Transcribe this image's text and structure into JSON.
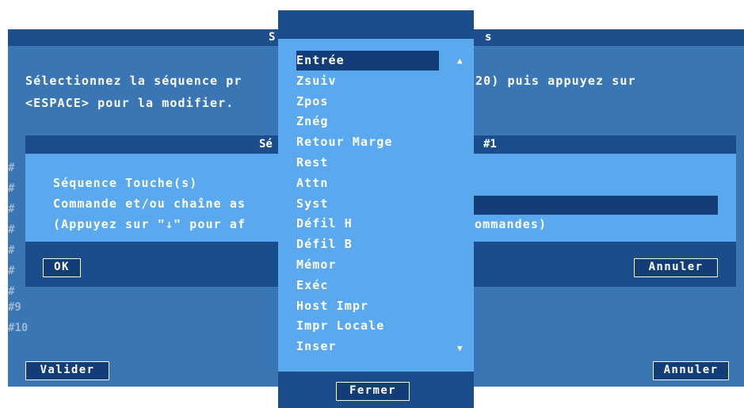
{
  "background_dialog": {
    "title_left": "S",
    "title_right": "s",
    "instruction_line1_left": "Sélectionnez la séquence pr",
    "instruction_line1_right": "20) puis appuyez sur",
    "instruction_line2": "<ESPACE> pour la modifier.",
    "rows": [
      {
        "label": "#9"
      },
      {
        "label": "#10"
      }
    ],
    "row_marker": "#",
    "validate_button": "Valider",
    "cancel_button": "Annuler"
  },
  "sequence_dialog": {
    "title_left": "Sé",
    "title_right": "#1",
    "line1": "Séquence Touche(s)",
    "line2": "Commande et/ou chaîne as",
    "line3_left": "(Appuyez sur \"↓\" pour af",
    "line3_right": "ommandes)",
    "ok_button": "OK",
    "cancel_button": "Annuler"
  },
  "command_list": {
    "items": [
      {
        "label": "Entrée",
        "selected": true
      },
      {
        "label": "Zsuiv"
      },
      {
        "label": "Zpos"
      },
      {
        "label": "Znég"
      },
      {
        "label": "Retour Marge"
      },
      {
        "label": "Rest"
      },
      {
        "label": "Attn"
      },
      {
        "label": "Syst"
      },
      {
        "label": "Défil H"
      },
      {
        "label": "Défil B"
      },
      {
        "label": "Mémor"
      },
      {
        "label": "Exéc"
      },
      {
        "label": "Host Impr"
      },
      {
        "label": "Impr Locale"
      },
      {
        "label": "Inser"
      }
    ],
    "scroll_up_icon": "▲",
    "scroll_down_icon": "▼",
    "close_button": "Fermer"
  },
  "colors": {
    "dialog_blue": "#3b76b4",
    "title_bar": "#1e4f8c",
    "light_blue": "#5aa9ee",
    "dark_navy": "#123d78"
  }
}
